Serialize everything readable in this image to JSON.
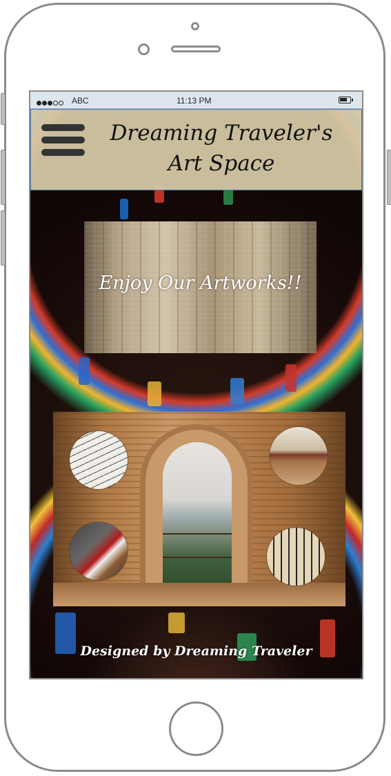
{
  "status_bar": {
    "signal_bars": 3,
    "carrier": "ABC",
    "time": "11:13 PM",
    "battery_icon": "battery-icon"
  },
  "header": {
    "menu_icon": "hamburger-menu-icon",
    "title_line1": "Dreaming Traveler's",
    "title_line2": "Art Space"
  },
  "banner": {
    "text": "Enjoy Our Artworks!!"
  },
  "gallery": {
    "circle_images": [
      "sheet-music",
      "art-gallery-hall",
      "books",
      "calligraphy"
    ]
  },
  "footer": {
    "text": "Designed by Dreaming Traveler"
  },
  "colors": {
    "header_bg": "#d7cba8",
    "header_border": "#4e74b4",
    "status_bar_bg": "#dde6ec",
    "text_light": "#ffffff",
    "text_dark": "#111111"
  }
}
